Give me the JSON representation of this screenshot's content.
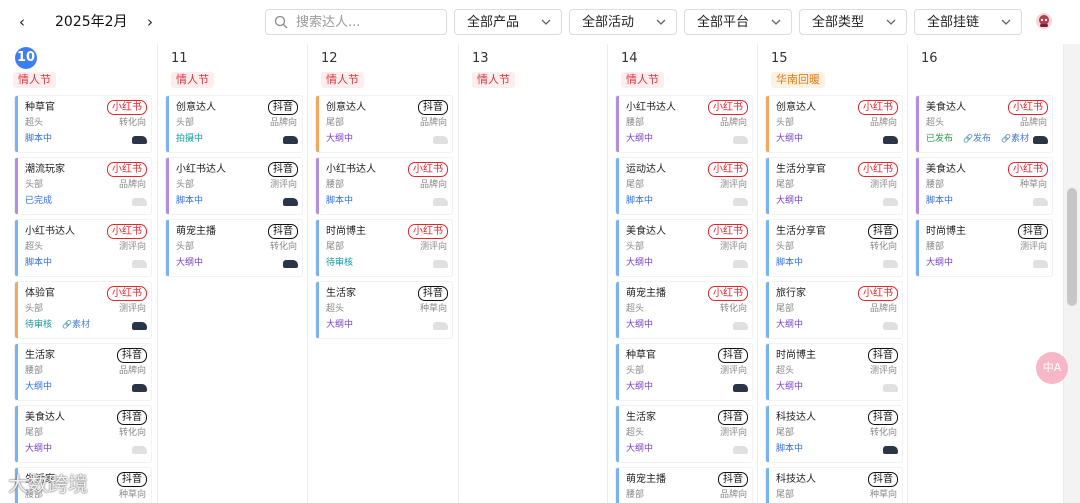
{
  "header": {
    "prev_icon": "chevron-left-icon",
    "next_icon": "chevron-right-icon",
    "month": "2025年2月",
    "search_placeholder": "搜索达人...",
    "filters": [
      "全部产品",
      "全部活动",
      "全部平台",
      "全部类型",
      "全部挂链"
    ],
    "avatar_icon": "user-avatar-icon"
  },
  "days": [
    {
      "num": "10",
      "today": true,
      "tag": "情人节",
      "tag_color": "red",
      "cards": [
        {
          "name": "种草官",
          "platform": "小红书",
          "level": "超头",
          "direction": "转化向",
          "status": "脚本中",
          "status_color": "blue",
          "accent": "blue",
          "shoe": "dark"
        },
        {
          "name": "潮流玩家",
          "platform": "小红书",
          "level": "头部",
          "direction": "品牌向",
          "status": "已完成",
          "status_color": "blue",
          "accent": "purple",
          "shoe": "light"
        },
        {
          "name": "小红书达人",
          "platform": "小红书",
          "level": "超头",
          "direction": "测评向",
          "status": "脚本中",
          "status_color": "blue",
          "accent": "blue",
          "shoe": "light"
        },
        {
          "name": "体验官",
          "platform": "小红书",
          "level": "头部",
          "direction": "测评向",
          "status": "待审核",
          "status_color": "teal",
          "extra": "素材",
          "accent": "orange",
          "shoe": "dark"
        },
        {
          "name": "生活家",
          "platform": "抖音",
          "level": "腰部",
          "direction": "品牌向",
          "status": "大纲中",
          "status_color": "blue",
          "accent": "blue",
          "shoe": "dark"
        },
        {
          "name": "美食达人",
          "platform": "抖音",
          "level": "尾部",
          "direction": "转化向",
          "status": "大纲中",
          "status_color": "purple",
          "accent": "blue",
          "shoe": "light"
        },
        {
          "name": "生活家",
          "platform": "抖音",
          "level": "腰部",
          "direction": "种草向",
          "status": "",
          "status_color": "blue",
          "accent": "blue",
          "shoe": "light"
        }
      ]
    },
    {
      "num": "11",
      "today": false,
      "tag": "情人节",
      "tag_color": "red",
      "cards": [
        {
          "name": "创意达人",
          "platform": "抖音",
          "level": "头部",
          "direction": "品牌向",
          "status": "拍摄中",
          "status_color": "teal",
          "accent": "blue",
          "shoe": "dark"
        },
        {
          "name": "小红书达人",
          "platform": "抖音",
          "level": "头部",
          "direction": "测评向",
          "status": "脚本中",
          "status_color": "blue",
          "accent": "purple",
          "shoe": "dark"
        },
        {
          "name": "萌宠主播",
          "platform": "抖音",
          "level": "头部",
          "direction": "转化向",
          "status": "大纲中",
          "status_color": "purple",
          "accent": "blue",
          "shoe": "dark"
        }
      ]
    },
    {
      "num": "12",
      "today": false,
      "tag": "情人节",
      "tag_color": "red",
      "cards": [
        {
          "name": "创意达人",
          "platform": "抖音",
          "level": "尾部",
          "direction": "品牌向",
          "status": "大纲中",
          "status_color": "purple",
          "accent": "orange",
          "shoe": "light"
        },
        {
          "name": "小红书达人",
          "platform": "小红书",
          "level": "腰部",
          "direction": "品牌向",
          "status": "脚本中",
          "status_color": "blue",
          "accent": "purple",
          "shoe": "light"
        },
        {
          "name": "时尚博主",
          "platform": "小红书",
          "level": "尾部",
          "direction": "测评向",
          "status": "待审核",
          "status_color": "teal",
          "accent": "blue",
          "shoe": "light"
        },
        {
          "name": "生活家",
          "platform": "抖音",
          "level": "超头",
          "direction": "种草向",
          "status": "大纲中",
          "status_color": "purple",
          "accent": "blue",
          "shoe": "light"
        }
      ]
    },
    {
      "num": "13",
      "today": false,
      "tag": "情人节",
      "tag_color": "red",
      "cards": []
    },
    {
      "num": "14",
      "today": false,
      "tag": "情人节",
      "tag_color": "red",
      "cards": [
        {
          "name": "小红书达人",
          "platform": "小红书",
          "level": "腰部",
          "direction": "品牌向",
          "status": "大纲中",
          "status_color": "purple",
          "accent": "purple",
          "shoe": "light"
        },
        {
          "name": "运动达人",
          "platform": "小红书",
          "level": "尾部",
          "direction": "测评向",
          "status": "脚本中",
          "status_color": "blue",
          "accent": "blue",
          "shoe": "light"
        },
        {
          "name": "美食达人",
          "platform": "小红书",
          "level": "头部",
          "direction": "测评向",
          "status": "大纲中",
          "status_color": "purple",
          "accent": "blue",
          "shoe": "light"
        },
        {
          "name": "萌宠主播",
          "platform": "小红书",
          "level": "超头",
          "direction": "转化向",
          "status": "大纲中",
          "status_color": "purple",
          "accent": "blue",
          "shoe": "light"
        },
        {
          "name": "种草官",
          "platform": "抖音",
          "level": "头部",
          "direction": "测评向",
          "status": "大纲中",
          "status_color": "purple",
          "accent": "blue",
          "shoe": "dark"
        },
        {
          "name": "生活家",
          "platform": "抖音",
          "level": "超头",
          "direction": "测评向",
          "status": "大纲中",
          "status_color": "purple",
          "accent": "blue",
          "shoe": "light"
        },
        {
          "name": "萌宠主播",
          "platform": "抖音",
          "level": "腰部",
          "direction": "品牌向",
          "status": "",
          "status_color": "blue",
          "accent": "blue",
          "shoe": "light"
        }
      ]
    },
    {
      "num": "15",
      "today": false,
      "tag": "华南回暖",
      "tag_color": "orange",
      "cards": [
        {
          "name": "创意达人",
          "platform": "小红书",
          "level": "头部",
          "direction": "品牌向",
          "status": "大纲中",
          "status_color": "purple",
          "accent": "orange",
          "shoe": "dark"
        },
        {
          "name": "生活分享官",
          "platform": "小红书",
          "level": "尾部",
          "direction": "测评向",
          "status": "大纲中",
          "status_color": "purple",
          "accent": "blue",
          "shoe": "light"
        },
        {
          "name": "生活分享官",
          "platform": "抖音",
          "level": "头部",
          "direction": "转化向",
          "status": "脚本中",
          "status_color": "blue",
          "accent": "blue",
          "shoe": "light"
        },
        {
          "name": "旅行家",
          "platform": "小红书",
          "level": "尾部",
          "direction": "品牌向",
          "status": "大纲中",
          "status_color": "purple",
          "accent": "blue",
          "shoe": "light"
        },
        {
          "name": "时尚博主",
          "platform": "抖音",
          "level": "超头",
          "direction": "测评向",
          "status": "大纲中",
          "status_color": "purple",
          "accent": "blue",
          "shoe": "light"
        },
        {
          "name": "科技达人",
          "platform": "抖音",
          "level": "尾部",
          "direction": "转化向",
          "status": "脚本中",
          "status_color": "blue",
          "accent": "blue",
          "shoe": "dark"
        },
        {
          "name": "科技达人",
          "platform": "抖音",
          "level": "尾部",
          "direction": "种草向",
          "status": "",
          "status_color": "blue",
          "accent": "blue",
          "shoe": "light"
        }
      ]
    },
    {
      "num": "16",
      "today": false,
      "tag": "",
      "tag_color": "red",
      "cards": [
        {
          "name": "美食达人",
          "platform": "小红书",
          "level": "超头",
          "direction": "品牌向",
          "status": "已发布",
          "status_color": "green",
          "extra": "发布",
          "extra2": "素材",
          "accent": "purple",
          "shoe": "dark"
        },
        {
          "name": "美食达人",
          "platform": "小红书",
          "level": "腰部",
          "direction": "种草向",
          "status": "脚本中",
          "status_color": "blue",
          "accent": "purple",
          "shoe": "light"
        },
        {
          "name": "时尚博主",
          "platform": "抖音",
          "level": "腰部",
          "direction": "测评向",
          "status": "大纲中",
          "status_color": "purple",
          "accent": "blue",
          "shoe": "light"
        }
      ]
    }
  ],
  "fab_text": "中A",
  "watermark": "大数跨境"
}
